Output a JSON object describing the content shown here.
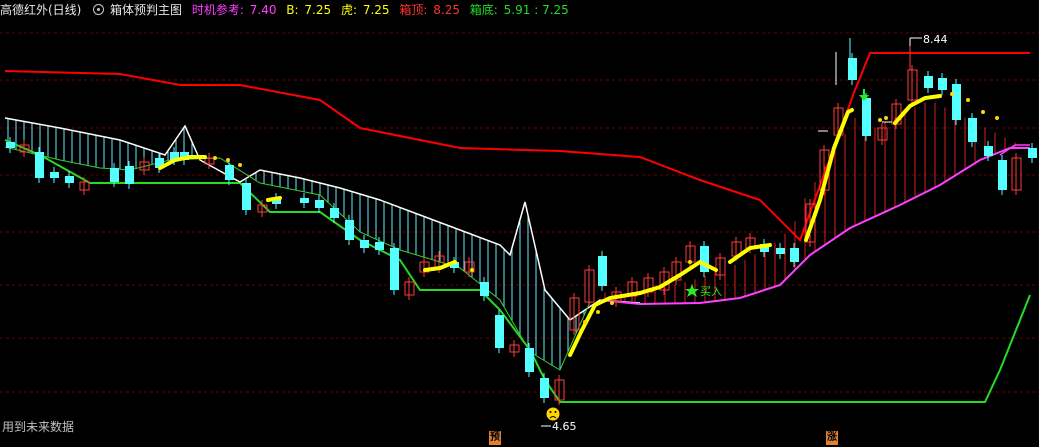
{
  "header": {
    "title": "高德红外(日线)",
    "indicator_name": "箱体预判主图",
    "timing_label": "时机参考:",
    "timing_value": "7.40",
    "b_label": "B:",
    "b_value": "7.25",
    "hu_label": "虎:",
    "hu_value": "7.25",
    "top_label": "箱顶:",
    "top_value": "8.25",
    "bottom_label": "箱底:",
    "bottom_value": "5.91 : 7.25"
  },
  "annotations": {
    "high_label": "8.44",
    "low_label": "4.65",
    "buy_label": "买入",
    "future_note": "用到未来数据",
    "marker_yu": "预",
    "marker_zhang": "涨"
  },
  "colors": {
    "background": "#000000",
    "grid": "#7a0000",
    "up_candle": "#ff3b3b",
    "down_candle": "#54ffff",
    "box_top_line": "#ff0000",
    "box_bottom_line": "#22dd22",
    "yellow_line": "#ffff00",
    "magenta_line": "#ff40ff",
    "white_line": "#ffffff",
    "marker_bg": "#e08030"
  },
  "icons": [
    "gear-icon",
    "star-icon",
    "down-arrow-icon",
    "sad-face-icon"
  ]
}
